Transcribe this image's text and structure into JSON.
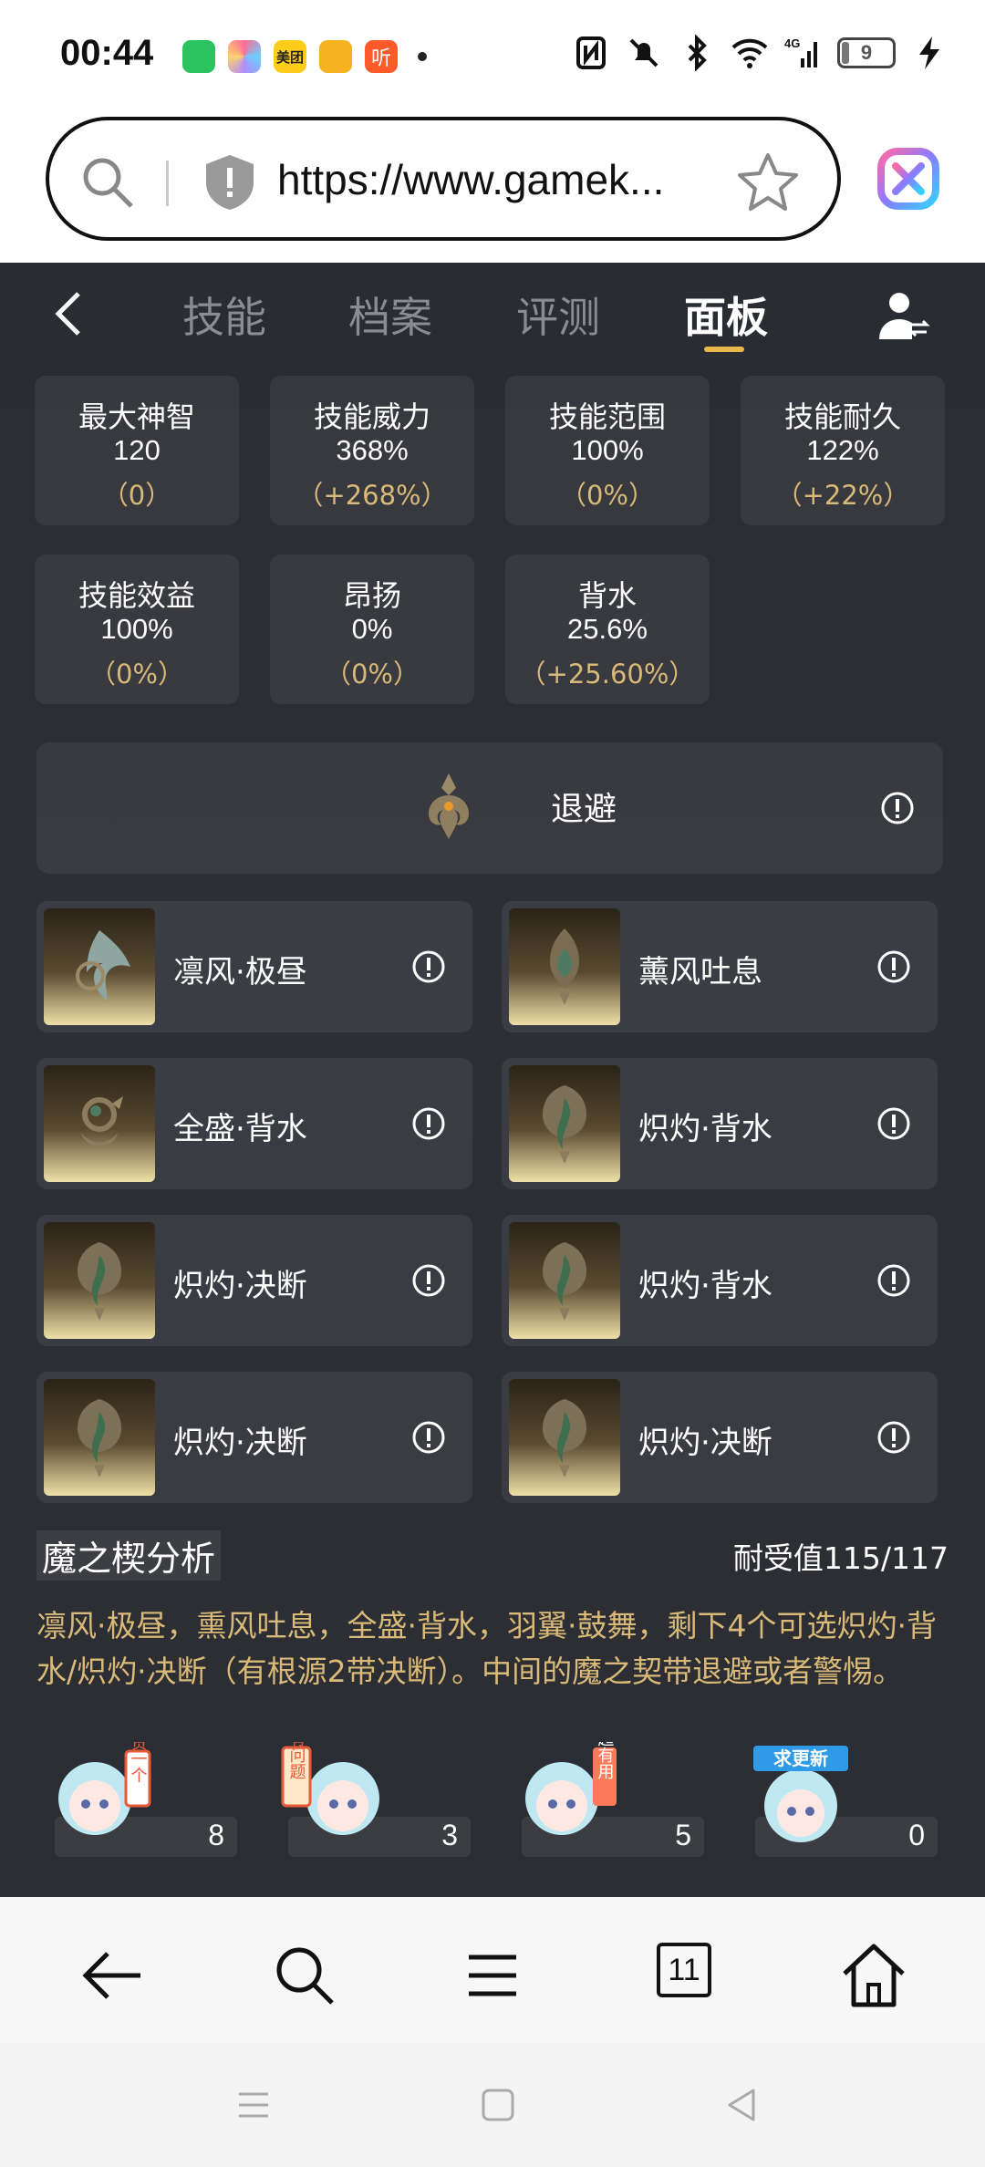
{
  "status_bar": {
    "time": "00:44",
    "battery": "9",
    "app_icons": [
      "wechat-icon",
      "pinwheel-app-icon",
      "meituan-icon",
      "weibo-icon",
      "listen-app-icon"
    ],
    "meituan_label": "美团",
    "listen_label": "听"
  },
  "browser": {
    "url": "https://www.gamek...",
    "tab_count": "11"
  },
  "game": {
    "tabs": [
      {
        "label": "技能"
      },
      {
        "label": "档案"
      },
      {
        "label": "评测"
      },
      {
        "label": "面板"
      }
    ],
    "active_tab": "面板",
    "stats": [
      {
        "label": "最大神智",
        "value": "120",
        "delta": "（0）"
      },
      {
        "label": "技能威力",
        "value": "368%",
        "delta": "（+268%）"
      },
      {
        "label": "技能范围",
        "value": "100%",
        "delta": "（0%）"
      },
      {
        "label": "技能耐久",
        "value": "122%",
        "delta": "（+22%）"
      },
      {
        "label": "技能效益",
        "value": "100%",
        "delta": "（0%）"
      },
      {
        "label": "昂扬",
        "value": "0%",
        "delta": "（0%）"
      },
      {
        "label": "背水",
        "value": "25.6%",
        "delta": "（+25.60%）"
      }
    ],
    "center_mod": {
      "name": "退避"
    },
    "mods": [
      {
        "name": "凛风·极昼"
      },
      {
        "name": "薰风吐息"
      },
      {
        "name": "全盛·背水"
      },
      {
        "name": "炽灼·背水"
      },
      {
        "name": "炽灼·决断"
      },
      {
        "name": "炽灼·背水"
      },
      {
        "name": "炽灼·决断"
      },
      {
        "name": "炽灼·决断"
      }
    ],
    "analysis": {
      "title": "魔之楔分析",
      "tolerance": "耐受值115/117",
      "text": "凛风·极昼，熏风吐息，全盛·背水，羽翼·鼓舞，剩下4个可选炽灼·背水/炽灼·决断（有根源2带决断）。中间的魔之契带退避或者警惕。"
    },
    "reactions": [
      {
        "sticker": "赞一个",
        "count": "8"
      },
      {
        "sticker": "有问题",
        "count": "3"
      },
      {
        "sticker": "超有用",
        "count": "5"
      },
      {
        "sticker": "求更新",
        "count": "0"
      }
    ]
  },
  "colors": {
    "accent_gold": "#e8b74b",
    "delta_gold": "#d9b978",
    "panel_bg": "#2b2d33"
  }
}
